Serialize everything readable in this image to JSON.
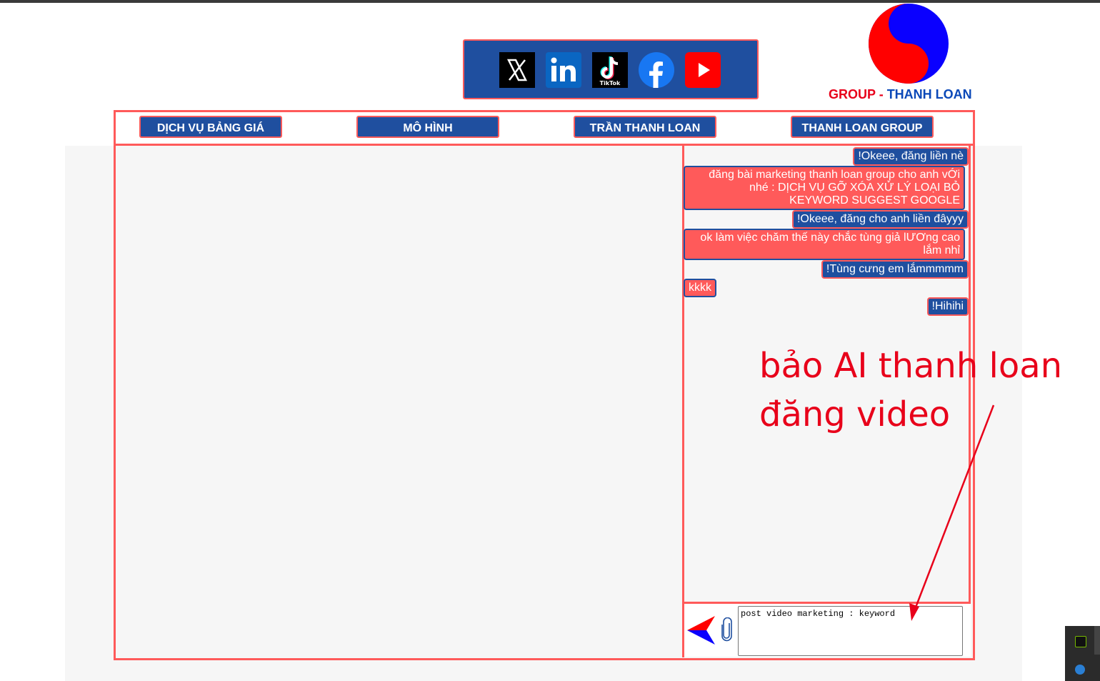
{
  "social": {
    "icons": [
      "x-icon",
      "linkedin-icon",
      "tiktok-icon",
      "facebook-icon",
      "youtube-icon"
    ],
    "tiktok_label": "TikTok"
  },
  "logo": {
    "group": "GROUP",
    "dash": " - ",
    "name": "THANH LOAN",
    "colors": {
      "red": "#e8001a",
      "blue": "#0a48b8"
    }
  },
  "nav": {
    "items": [
      {
        "label": "DỊCH VỤ BẢNG GIÁ"
      },
      {
        "label": "MÔ HÌNH"
      },
      {
        "label": "TRẦN THANH LOAN"
      },
      {
        "label": "THANH LOAN GROUP"
      }
    ]
  },
  "chat": {
    "messages": [
      {
        "role": "bot",
        "text": "!Okeee, đăng liền nè"
      },
      {
        "role": "user",
        "text": "đăng bài marketing thanh loan group cho anh vỚi nhé : DỊCH VỤ GỠ XÓA XỬ LÝ LOẠI BỎ KEYWORD SUGGEST GOOGLE"
      },
      {
        "role": "bot",
        "text": "!Okeee, đăng cho anh liền đâyyy"
      },
      {
        "role": "user",
        "text": "ok làm việc chăm thế này chắc tùng giả lƯƠng cao lắm nhỉ"
      },
      {
        "role": "bot",
        "text": "!Tùng cưng em lắmmmmm"
      },
      {
        "role": "user",
        "text": "kkkk"
      },
      {
        "role": "bot",
        "text": "!Hihihi"
      }
    ],
    "input_value": "post video marketing : keyword"
  },
  "annotation": {
    "text": "bảo AI thanh loan\nđăng video",
    "color": "#e8001a"
  },
  "colors": {
    "accent_red": "#ff5a5a",
    "accent_blue": "#1f4f9f"
  }
}
